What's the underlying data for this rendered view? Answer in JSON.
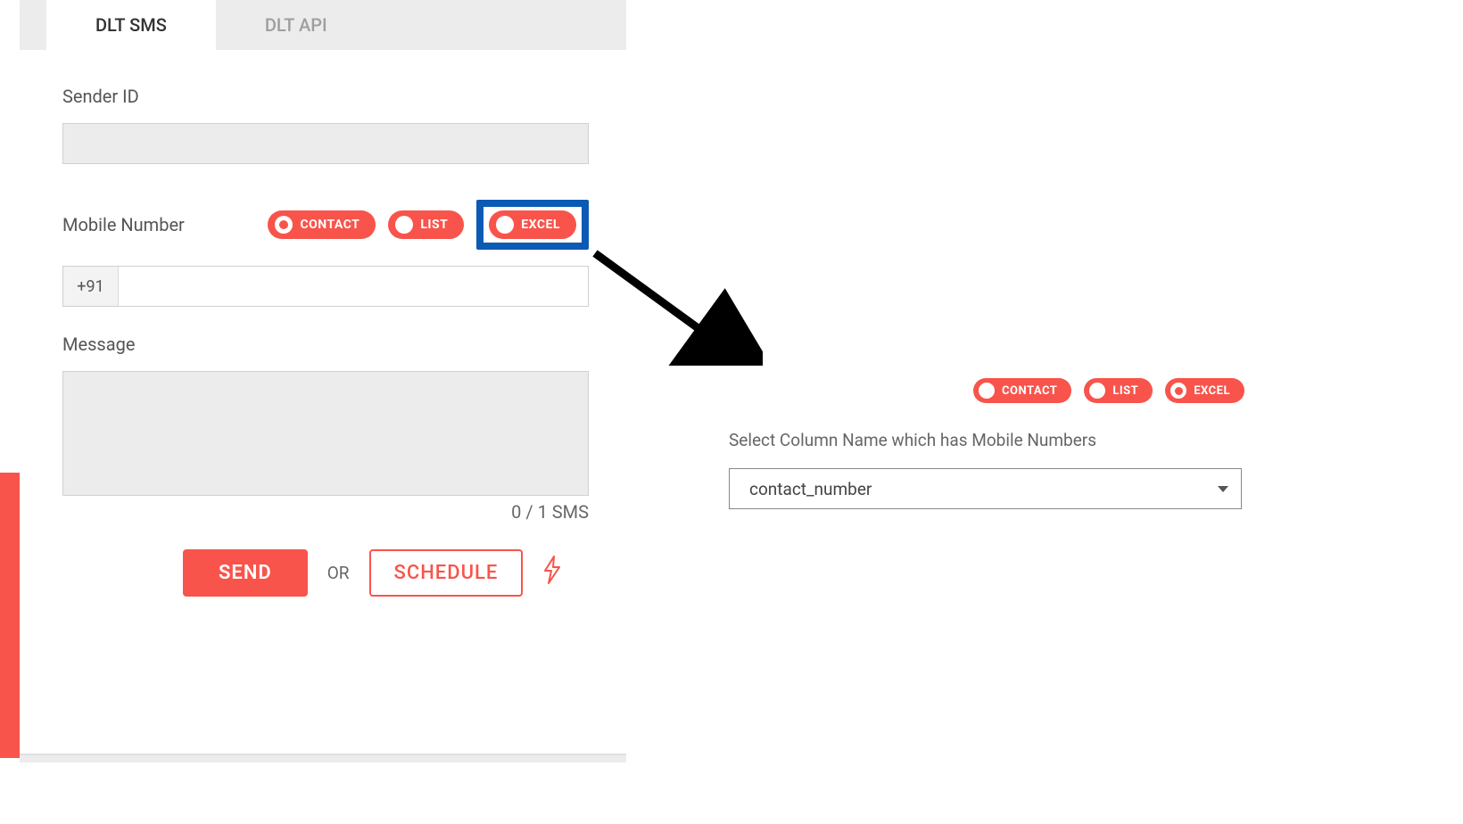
{
  "tabs": [
    "DLT SMS",
    "DLT API"
  ],
  "active_tab": 0,
  "fields": {
    "sender_id": {
      "label": "Sender ID",
      "value": ""
    },
    "mobile": {
      "label": "Mobile Number",
      "prefix": "+91",
      "value": ""
    },
    "message": {
      "label": "Message",
      "counter": "0 / 1 SMS"
    }
  },
  "pills": {
    "contact": "CONTACT",
    "list": "LIST",
    "excel": "EXCEL"
  },
  "left_selected": "contact",
  "right_selected": "excel",
  "actions": {
    "send": "SEND",
    "or": "OR",
    "schedule": "SCHEDULE"
  },
  "right_panel": {
    "label": "Select Column Name which has Mobile Numbers",
    "value": "contact_number"
  }
}
